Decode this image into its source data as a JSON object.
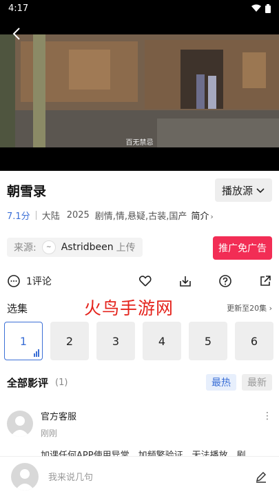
{
  "status": {
    "time": "4:17",
    "icons": [
      "wifi-icon",
      "battery-icon"
    ]
  },
  "video": {
    "subtitle": "百无禁忌"
  },
  "show": {
    "title": "朝雪录",
    "source_label": "播放源",
    "score": "7.1分",
    "region": "大陆",
    "year": "2025",
    "genres": "剧情,情,悬疑,古装,国产",
    "intro_label": "简介"
  },
  "uploader": {
    "prefix": "来源:",
    "name": "Astridbeen",
    "suffix": "上传"
  },
  "ad_button": "推广免广告",
  "actions": {
    "comment_count": "1评论"
  },
  "episodes": {
    "label": "选集",
    "watermark": "火鸟手游网",
    "update": "更新至20集",
    "items": [
      "1",
      "2",
      "3",
      "4",
      "5",
      "6"
    ],
    "selected": "1"
  },
  "reviews": {
    "title": "全部影评",
    "count": "(1)",
    "sort_hot": "最热",
    "sort_new": "最新",
    "items": [
      {
        "name": "官方客服",
        "time": "刚刚",
        "text": "加课任何APP使用异常，加频繁验证，无法播放，剧"
      }
    ]
  },
  "composer": {
    "placeholder": "我来说几句"
  },
  "colors": {
    "accent": "#3b6fd6",
    "ad": "#f22d55",
    "watermark": "#e4231c"
  }
}
